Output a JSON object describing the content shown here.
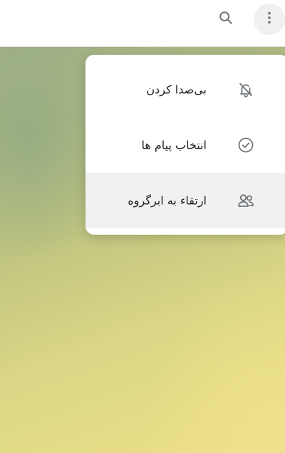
{
  "header": {
    "search_icon": "search-icon",
    "more_icon": "more-vertical-icon"
  },
  "menu": {
    "items": [
      {
        "label": "بی‌صدا کردن",
        "icon": "bell-off-icon"
      },
      {
        "label": "انتخاب پیام ها",
        "icon": "check-circle-icon"
      },
      {
        "label": "ارتقاء به ابرگروه",
        "icon": "users-icon"
      }
    ]
  },
  "colors": {
    "menu_background": "#ffffff",
    "hover_background": "#f1f1f1",
    "icon_color": "#707579",
    "text_color": "#222222"
  }
}
